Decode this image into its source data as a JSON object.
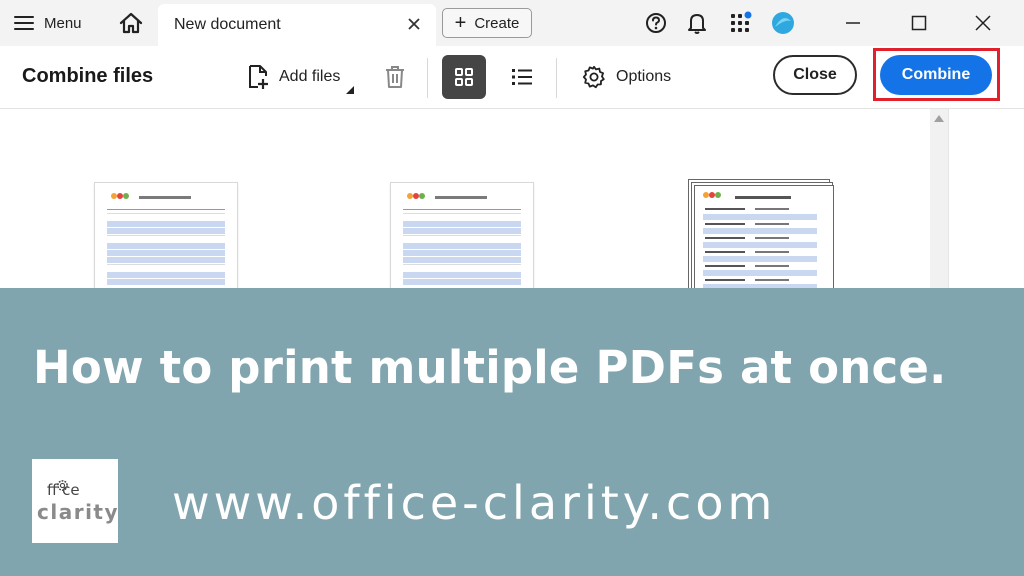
{
  "titlebar": {
    "menu_label": "Menu",
    "tab_title": "New document",
    "create_label": "Create",
    "icons": [
      "hamburger-icon",
      "home-icon",
      "close-icon",
      "plus-icon",
      "help-icon",
      "bell-icon",
      "apps-icon",
      "avatar",
      "minimize-icon",
      "maximize-icon",
      "close-window-icon"
    ]
  },
  "toolbar": {
    "title": "Combine files",
    "add_files_label": "Add files",
    "options_label": "Options",
    "close_label": "Close",
    "combine_label": "Combine",
    "view_mode": "grid",
    "accent_color": "#1473e6",
    "highlight_color": "#e0202a"
  },
  "documents": [
    {
      "kind": "single-page"
    },
    {
      "kind": "single-page"
    },
    {
      "kind": "multi-page"
    }
  ],
  "banner": {
    "headline": "How to print multiple PDFs at once.",
    "logo_top": "ff ce",
    "logo_bottom": "clarity",
    "url": "www.office-clarity.com",
    "background_color": "#80a5ae"
  }
}
